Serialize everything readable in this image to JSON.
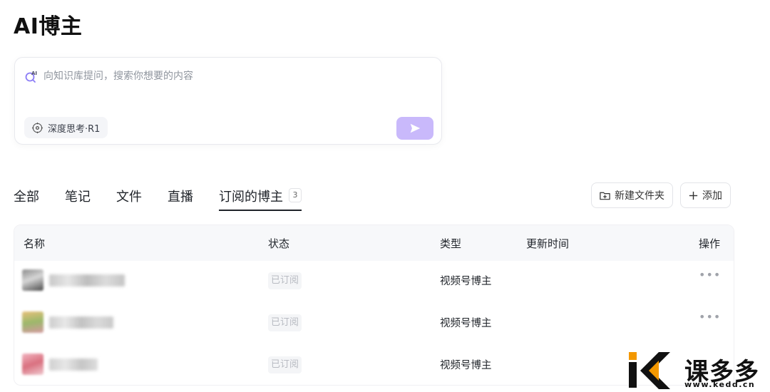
{
  "page": {
    "title": "AI博主"
  },
  "ask": {
    "placeholder": "向知识库提问，搜索你想要的内容",
    "deep_think_label": "深度思考·R1"
  },
  "tabs": [
    {
      "label": "全部"
    },
    {
      "label": "笔记"
    },
    {
      "label": "文件"
    },
    {
      "label": "直播"
    },
    {
      "label": "订阅的博主",
      "badge": "3",
      "active": true
    }
  ],
  "toolbar": {
    "new_folder_label": "新建文件夹",
    "add_label": "添加"
  },
  "table": {
    "headers": {
      "name": "名称",
      "status": "状态",
      "type": "类型",
      "updated": "更新时间",
      "actions": "操作"
    },
    "rows": [
      {
        "status": "已订阅",
        "type": "视频号博主",
        "actions": "•••"
      },
      {
        "status": "已订阅",
        "type": "视频号博主",
        "actions": "•••"
      },
      {
        "status": "已订阅",
        "type": "视频号博主",
        "actions": ""
      }
    ]
  },
  "watermark": {
    "text": "课多多",
    "url": "www.kedd.cn"
  },
  "colors": {
    "accent_purple": "#c9b9fb",
    "brand_orange": "#f39800"
  }
}
